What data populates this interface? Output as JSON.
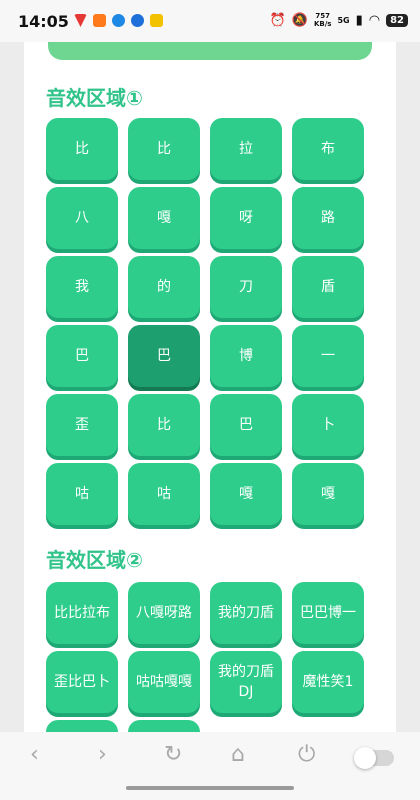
{
  "status": {
    "time": "14:05",
    "net_speed_value": "757",
    "net_speed_unit": "KB/s",
    "signal": "5G",
    "battery": "82"
  },
  "section1": {
    "title": "音效区域①",
    "buttons": [
      "比",
      "比",
      "拉",
      "布",
      "八",
      "嘎",
      "呀",
      "路",
      "我",
      "的",
      "刀",
      "盾",
      "巴",
      "巴",
      "博",
      "一",
      "歪",
      "比",
      "巴",
      "卜",
      "咕",
      "咕",
      "嘎",
      "嘎"
    ],
    "active_index": 13
  },
  "section2": {
    "title": "音效区域②",
    "buttons": [
      "比比拉布",
      "八嘎呀路",
      "我的刀盾",
      "巴巴博一",
      "歪比巴卜",
      "咕咕嘎嘎",
      "我的刀盾DJ",
      "魔性笑1",
      "",
      ""
    ]
  },
  "colors": {
    "accent": "#31c48a",
    "button": "#2fcd8b",
    "button_active": "#1d9f70"
  },
  "icons": {
    "back": "chevron-left-icon",
    "forward": "chevron-right-icon",
    "refresh": "refresh-icon",
    "home": "home-icon",
    "power": "power-icon"
  }
}
